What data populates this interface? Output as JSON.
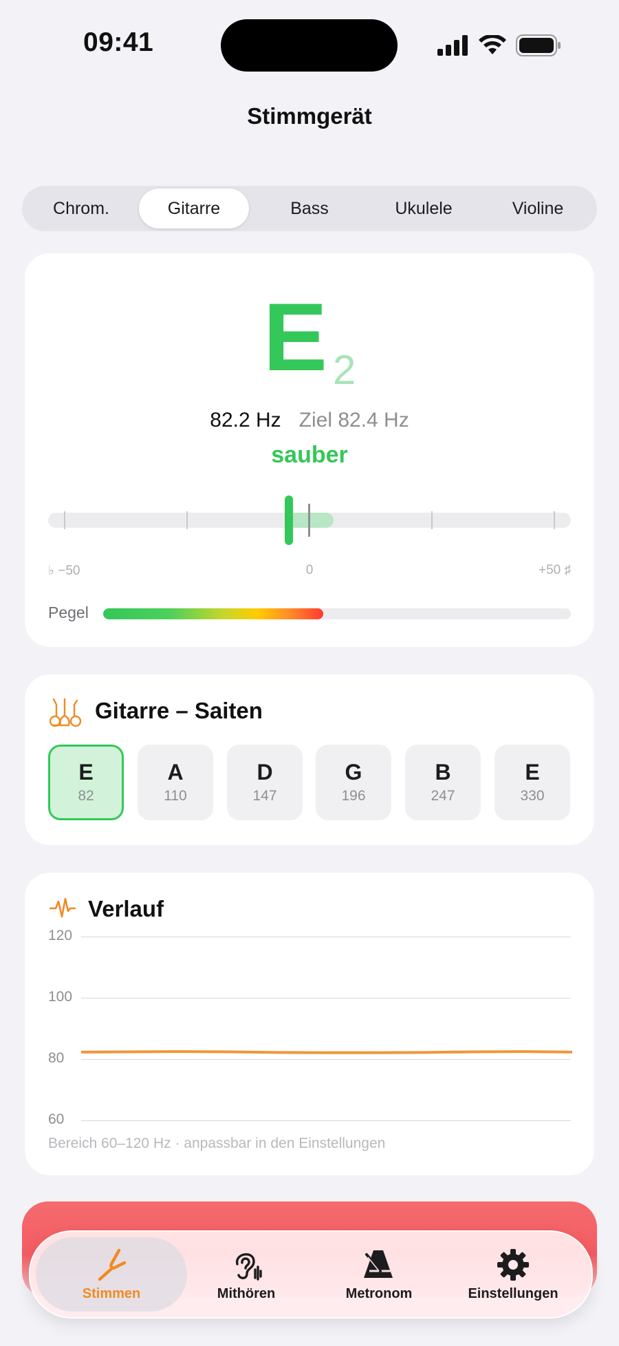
{
  "status": {
    "time": "09:41"
  },
  "header": {
    "title": "Stimmgerät"
  },
  "segments": [
    {
      "label": "Chrom.",
      "active": false
    },
    {
      "label": "Gitarre",
      "active": true
    },
    {
      "label": "Bass",
      "active": false
    },
    {
      "label": "Ukulele",
      "active": false
    },
    {
      "label": "Violine",
      "active": false
    }
  ],
  "tuner": {
    "note": "E",
    "octave": "2",
    "frequency": "82.2 Hz",
    "target": "Ziel 82.4 Hz",
    "state": "sauber",
    "scale": {
      "min": "♭ −50",
      "zero": "0",
      "max": "+50 ♯"
    },
    "cents_offset": -4,
    "level_label": "Pegel",
    "level_fraction": 0.47,
    "colors": {
      "in_tune": "#34c759",
      "accent": "#f08a24"
    }
  },
  "strings": {
    "title": "Gitarre – Saiten",
    "icon": "guitars-icon",
    "items": [
      {
        "note": "E",
        "hz": "82",
        "active": true
      },
      {
        "note": "A",
        "hz": "110",
        "active": false
      },
      {
        "note": "D",
        "hz": "147",
        "active": false
      },
      {
        "note": "G",
        "hz": "196",
        "active": false
      },
      {
        "note": "B",
        "hz": "247",
        "active": false
      },
      {
        "note": "E",
        "hz": "330",
        "active": false
      }
    ]
  },
  "history": {
    "title": "Verlauf",
    "icon": "waveform-icon",
    "hint": "Bereich 60–120 Hz · anpassbar in den Einstellungen"
  },
  "chart_data": {
    "type": "line",
    "ylim": [
      60,
      120
    ],
    "yticks": [
      "120",
      "100",
      "80",
      "60"
    ],
    "series": [
      {
        "values": [
          82.4,
          82.5,
          82.6,
          82.5,
          82.3,
          82.2,
          82.2,
          82.3,
          82.5,
          82.6,
          82.4
        ]
      }
    ],
    "color": "#f0963a"
  },
  "tabs": [
    {
      "label": "Stimmen",
      "icon": "tuning-fork-icon",
      "active": true
    },
    {
      "label": "Mithören",
      "icon": "ear-icon",
      "active": false
    },
    {
      "label": "Metronom",
      "icon": "metronome-icon",
      "active": false
    },
    {
      "label": "Einstellungen",
      "icon": "gear-icon",
      "active": false
    }
  ]
}
